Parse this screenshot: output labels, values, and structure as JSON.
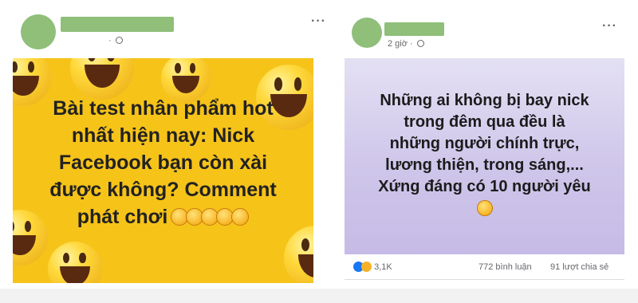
{
  "posts": [
    {
      "meta": "·",
      "more": "···",
      "image_text_lines": [
        "Bài test nhân phẩm hot",
        "nhất hiện nay: Nick",
        "Facebook bạn còn xài",
        "được không? Comment",
        "phát chơi"
      ],
      "image_bg": "#f6c319"
    },
    {
      "meta": "2 giờ ·",
      "more": "···",
      "image_text_lines": [
        "Những ai không bị bay nick",
        "trong đêm qua đều là",
        "những người chính trực,",
        "lương thiện, trong sáng,...",
        "Xứng đáng có 10 người yêu"
      ],
      "image_bg": "#d6cff0",
      "reactions": {
        "count": "3,1K",
        "icons": [
          "like-icon",
          "haha-icon"
        ]
      },
      "comments": "772 bình luận",
      "shares": "91 lượt chia sẻ"
    }
  ],
  "colors": {
    "placeholder_green": "#8fbf79",
    "text_meta": "#65676b"
  }
}
